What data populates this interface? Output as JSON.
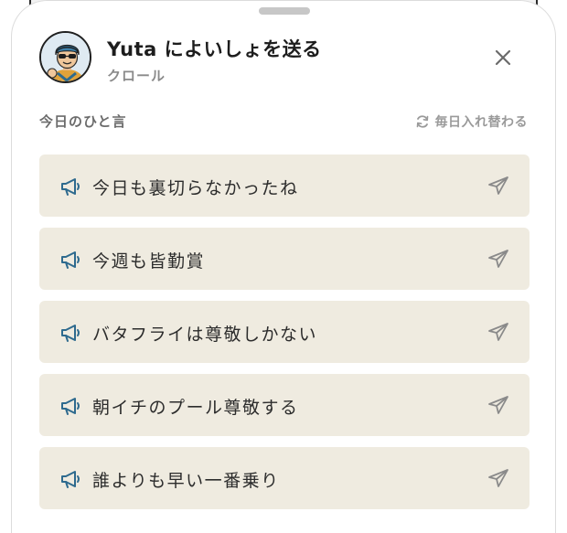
{
  "sheet": {
    "title": "Yuta によいしょを送る",
    "subtitle": "クロール",
    "close_icon": "close-icon",
    "avatar_icon": "swimmer-avatar"
  },
  "section": {
    "label": "今日のひと言",
    "daily_note": "毎日入れ替わる",
    "refresh_icon": "refresh-icon"
  },
  "phrases": [
    {
      "text": "今日も裏切らなかったね"
    },
    {
      "text": "今週も皆勤賞"
    },
    {
      "text": "バタフライは尊敬しかない"
    },
    {
      "text": "朝イチのプール尊敬する"
    },
    {
      "text": "誰よりも早い一番乗り"
    }
  ],
  "colors": {
    "phrase_bg": "#efebe0",
    "accent_blue": "#2e6a8e",
    "muted": "#9a9a9a"
  }
}
